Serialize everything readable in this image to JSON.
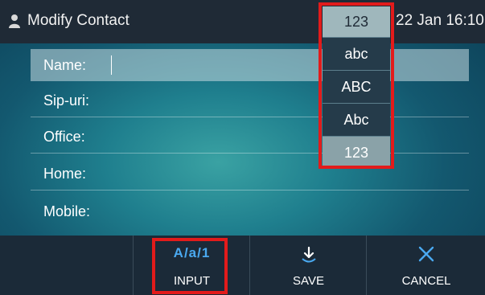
{
  "header": {
    "title": "Modify Contact",
    "datetime": "22 Jan 16:10",
    "icon": "person-icon"
  },
  "input_mode": {
    "current": "123",
    "options": [
      "abc",
      "ABC",
      "Abc",
      "123"
    ],
    "selected": "123"
  },
  "form": {
    "fields": [
      {
        "label": "Name:",
        "value": ""
      },
      {
        "label": "Sip-uri:",
        "value": ""
      },
      {
        "label": "Office:",
        "value": ""
      },
      {
        "label": "Home:",
        "value": ""
      },
      {
        "label": "Mobile:",
        "value": ""
      }
    ]
  },
  "softkeys": {
    "input": {
      "label": "INPUT",
      "icon_text": "A/a/1"
    },
    "save": {
      "label": "SAVE",
      "icon": "save-arrow-icon"
    },
    "cancel": {
      "label": "CANCEL",
      "icon": "close-icon"
    }
  },
  "colors": {
    "highlight": "#e21b1b",
    "accent": "#4aa9f0",
    "bar": "#1f2a36"
  }
}
